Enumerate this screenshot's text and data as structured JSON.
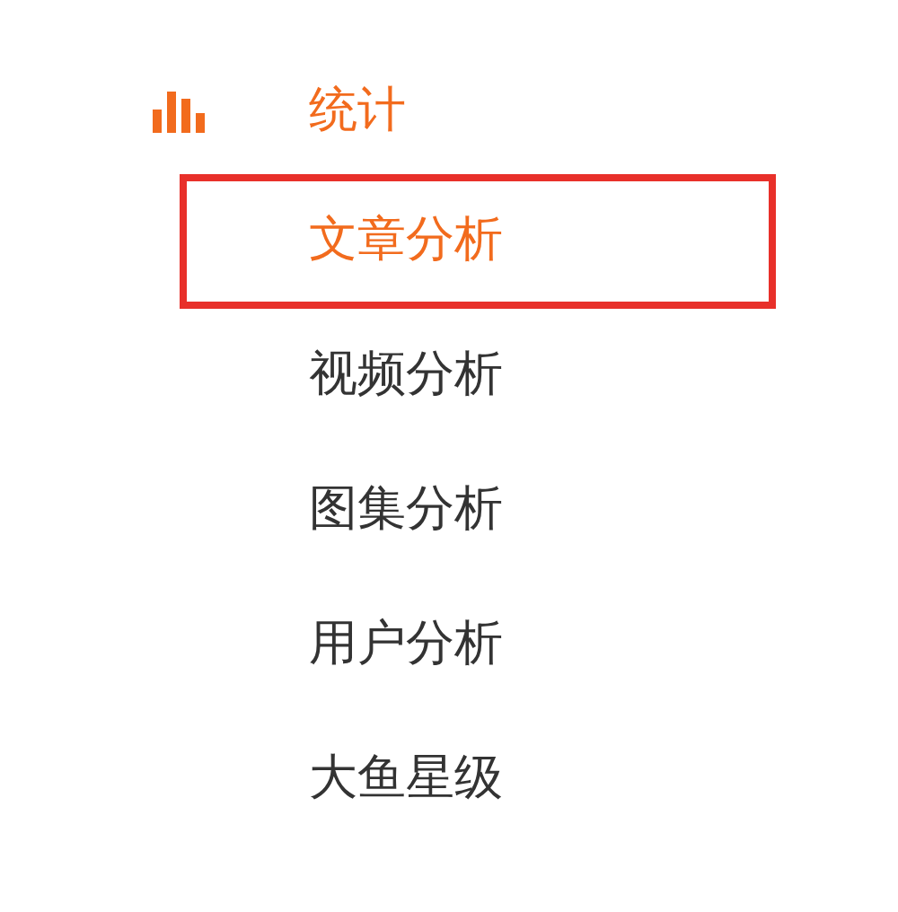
{
  "section": {
    "title": "统计"
  },
  "items": [
    {
      "label": "文章分析",
      "selected": true
    },
    {
      "label": "视频分析",
      "selected": false
    },
    {
      "label": "图集分析",
      "selected": false
    },
    {
      "label": "用户分析",
      "selected": false
    },
    {
      "label": "大鱼星级",
      "selected": false
    }
  ]
}
